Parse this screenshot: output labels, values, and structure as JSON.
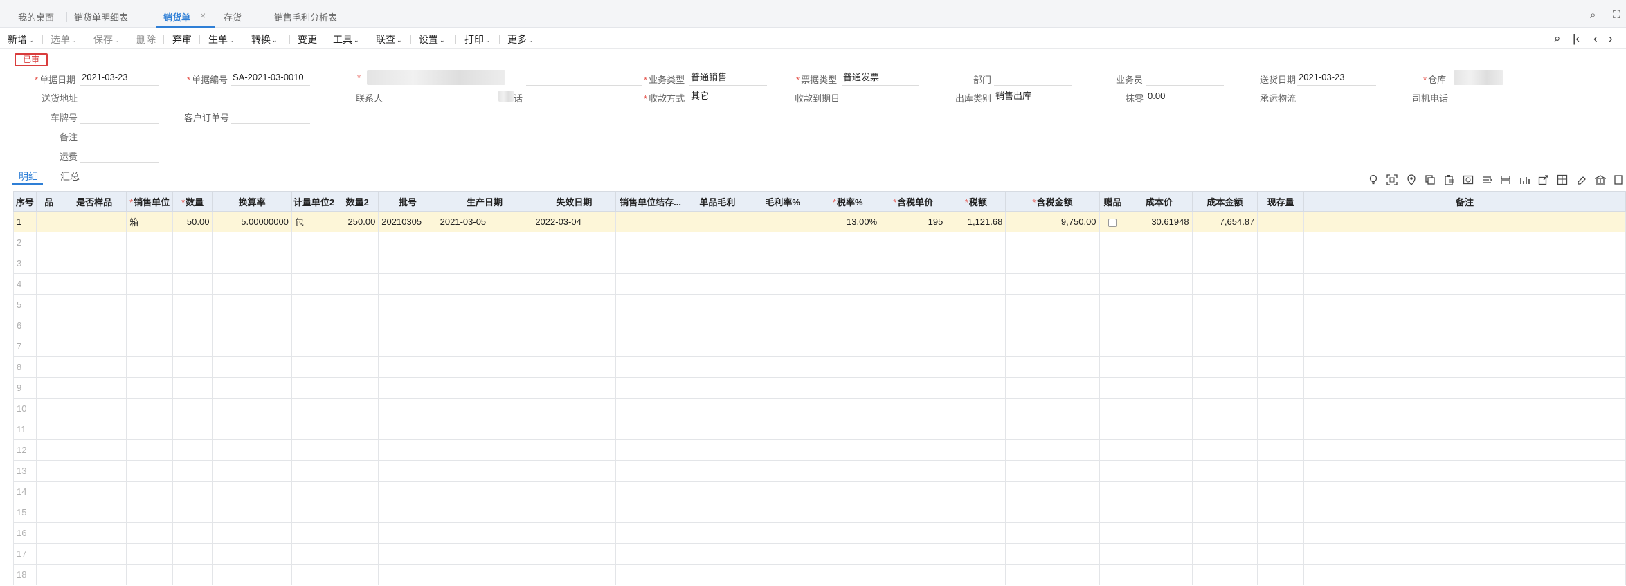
{
  "tabs": [
    {
      "label": "我的桌面"
    },
    {
      "label": "销货单明细表"
    },
    {
      "label": "销货单"
    },
    {
      "label": "存货"
    },
    {
      "label": "销售毛利分析表"
    }
  ],
  "tab_close": "×",
  "top_icons": {
    "search": "⌕",
    "expand": "⛶"
  },
  "toolbar": [
    {
      "label": "新增",
      "caret": "⌄"
    },
    {
      "label": "选单",
      "caret": "⌄"
    },
    {
      "label": "保存",
      "caret": "⌄"
    },
    {
      "label": "删除",
      "caret": ""
    },
    {
      "label": "弃审",
      "caret": ""
    },
    {
      "label": "生单",
      "caret": "⌄"
    },
    {
      "label": "转换",
      "caret": "⌄"
    },
    {
      "label": "变更",
      "caret": ""
    },
    {
      "label": "工具",
      "caret": "⌄"
    },
    {
      "label": "联查",
      "caret": "⌄"
    },
    {
      "label": "设置",
      "caret": "⌄"
    },
    {
      "label": "打印",
      "caret": "⌄"
    },
    {
      "label": "更多",
      "caret": "⌄"
    }
  ],
  "nav_icons": {
    "find": "⌕",
    "first": "|‹",
    "prev": "‹",
    "next": "›",
    "last": "›|"
  },
  "status_stamp": "已审",
  "form": {
    "doc_date": {
      "label": "单据日期",
      "value": "2021-03-23"
    },
    "doc_no": {
      "label": "单据编号",
      "value": "SA-2021-03-0010"
    },
    "biz_type": {
      "label": "业务类型",
      "value": "普通销售"
    },
    "invoice_type": {
      "label": "票据类型",
      "value": "普通发票"
    },
    "dept": {
      "label": "部门",
      "value": ""
    },
    "salesman": {
      "label": "业务员",
      "value": ""
    },
    "delivery_date": {
      "label": "送货日期",
      "value": "2021-03-23"
    },
    "warehouse": {
      "label": "仓库",
      "value": ""
    },
    "delivery_addr": {
      "label": "送货地址",
      "value": ""
    },
    "contact": {
      "label": "联系人",
      "value": ""
    },
    "phone": {
      "label": "话",
      "value": ""
    },
    "pay_method": {
      "label": "收款方式",
      "value": "其它"
    },
    "due_date": {
      "label": "收款到期日",
      "value": ""
    },
    "out_type": {
      "label": "出库类别",
      "value": "销售出库"
    },
    "discount": {
      "label": "抹零",
      "value": "0.00"
    },
    "carrier": {
      "label": "承运物流",
      "value": ""
    },
    "driver_phone": {
      "label": "司机电话",
      "value": ""
    },
    "plate_no": {
      "label": "车牌号",
      "value": ""
    },
    "cust_order_no": {
      "label": "客户订单号",
      "value": ""
    },
    "remark": {
      "label": "备注",
      "value": ""
    },
    "freight": {
      "label": "运费",
      "value": ""
    }
  },
  "subtabs": [
    {
      "label": "明细"
    },
    {
      "label": "汇总"
    }
  ],
  "grid_icons": [
    "bulb-icon",
    "scan-icon",
    "location-icon",
    "copy-icon",
    "paste-icon",
    "image-icon",
    "list-icon",
    "split-icon",
    "chart-icon",
    "export-icon",
    "layout-icon",
    "eraser-icon",
    "bank-icon",
    "more-icon"
  ],
  "grid": {
    "columns": [
      {
        "label": "序号",
        "req": ""
      },
      {
        "label": "品",
        "req": ""
      },
      {
        "label": "是否样品",
        "req": ""
      },
      {
        "label": "销售单位",
        "req": "*"
      },
      {
        "label": "数量",
        "req": "*"
      },
      {
        "label": "换算率",
        "req": ""
      },
      {
        "label": "计量单位2",
        "req": ""
      },
      {
        "label": "数量2",
        "req": ""
      },
      {
        "label": "批号",
        "req": ""
      },
      {
        "label": "生产日期",
        "req": ""
      },
      {
        "label": "失效日期",
        "req": ""
      },
      {
        "label": "销售单位结存...",
        "req": ""
      },
      {
        "label": "单品毛利",
        "req": ""
      },
      {
        "label": "毛利率%",
        "req": ""
      },
      {
        "label": "税率%",
        "req": "*"
      },
      {
        "label": "含税单价",
        "req": "*"
      },
      {
        "label": "税额",
        "req": "*"
      },
      {
        "label": "含税金额",
        "req": "*"
      },
      {
        "label": "赠品",
        "req": ""
      },
      {
        "label": "成本价",
        "req": ""
      },
      {
        "label": "成本金额",
        "req": ""
      },
      {
        "label": "现存量",
        "req": ""
      },
      {
        "label": "备注",
        "req": ""
      }
    ],
    "rows": [
      {
        "no": "1",
        "cells": [
          "",
          "",
          "箱",
          "50.00",
          "5.00000000",
          "包",
          "250.00",
          "20210305",
          "2021-03-05",
          "2022-03-04",
          "",
          "",
          "",
          "13.00%",
          "195",
          "1,121.68",
          "9,750.00",
          "",
          "30.61948",
          "7,654.87",
          "",
          ""
        ]
      },
      {
        "no": "2"
      },
      {
        "no": "3"
      },
      {
        "no": "4"
      },
      {
        "no": "5"
      },
      {
        "no": "6"
      },
      {
        "no": "7"
      },
      {
        "no": "8"
      },
      {
        "no": "9"
      },
      {
        "no": "10"
      },
      {
        "no": "11"
      },
      {
        "no": "12"
      },
      {
        "no": "13"
      },
      {
        "no": "14"
      },
      {
        "no": "15"
      },
      {
        "no": "16"
      },
      {
        "no": "17"
      },
      {
        "no": "18"
      }
    ]
  }
}
